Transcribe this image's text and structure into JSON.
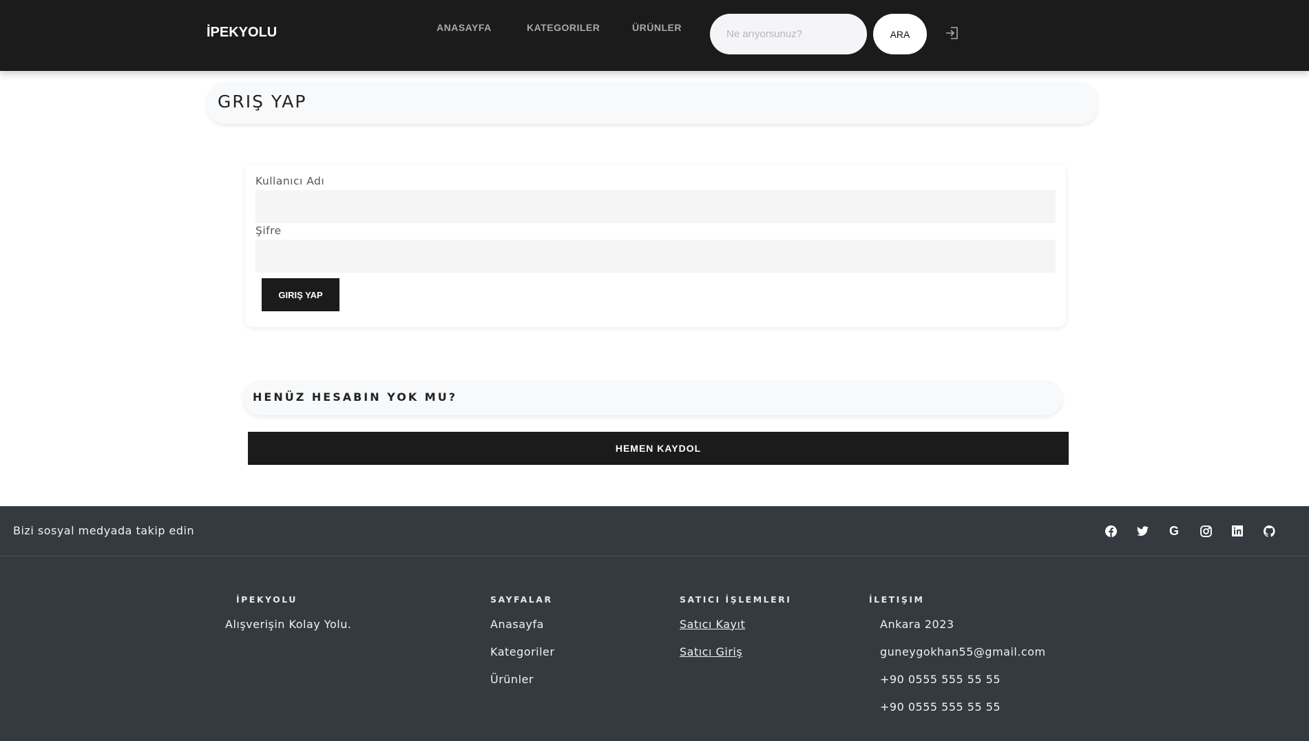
{
  "nav": {
    "brand": "İPEKYOLU",
    "links": [
      "ANASAYFA",
      "KATEGORILER",
      "ÜRÜNLER"
    ],
    "search_placeholder": "Ne arıyorsunuz?",
    "search_button": "ARA"
  },
  "login": {
    "title": "GRIŞ YAP",
    "username_label": "Kullanıcı Adı",
    "password_label": "Şifre",
    "submit": "GIRIŞ YAP"
  },
  "signup": {
    "prompt": "HENÜZ HESABIN YOK MU?",
    "button": "HEMEN KAYDOL"
  },
  "footer": {
    "social_text": "Bizi sosyal medyada takip edin",
    "social_icons": [
      "facebook-icon",
      "twitter-icon",
      "google-icon",
      "instagram-icon",
      "linkedin-icon",
      "github-icon"
    ],
    "col1": {
      "heading": "İPEKYOLU",
      "text": "Alışverişin Kolay Yolu."
    },
    "col2": {
      "heading": "SAYFALAR",
      "items": [
        "Anasayfa",
        "Kategoriler",
        "Ürünler"
      ]
    },
    "col3": {
      "heading": "SATICI İŞLEMLERI",
      "items": [
        "Satıcı Kayıt",
        "Satıcı Giriş"
      ]
    },
    "col4": {
      "heading": "İLETIŞIM",
      "items": [
        "Ankara 2023",
        "guneygokhan55@gmail.com",
        "+90 0555 555 55 55",
        "+90 0555 555 55 55"
      ]
    }
  }
}
